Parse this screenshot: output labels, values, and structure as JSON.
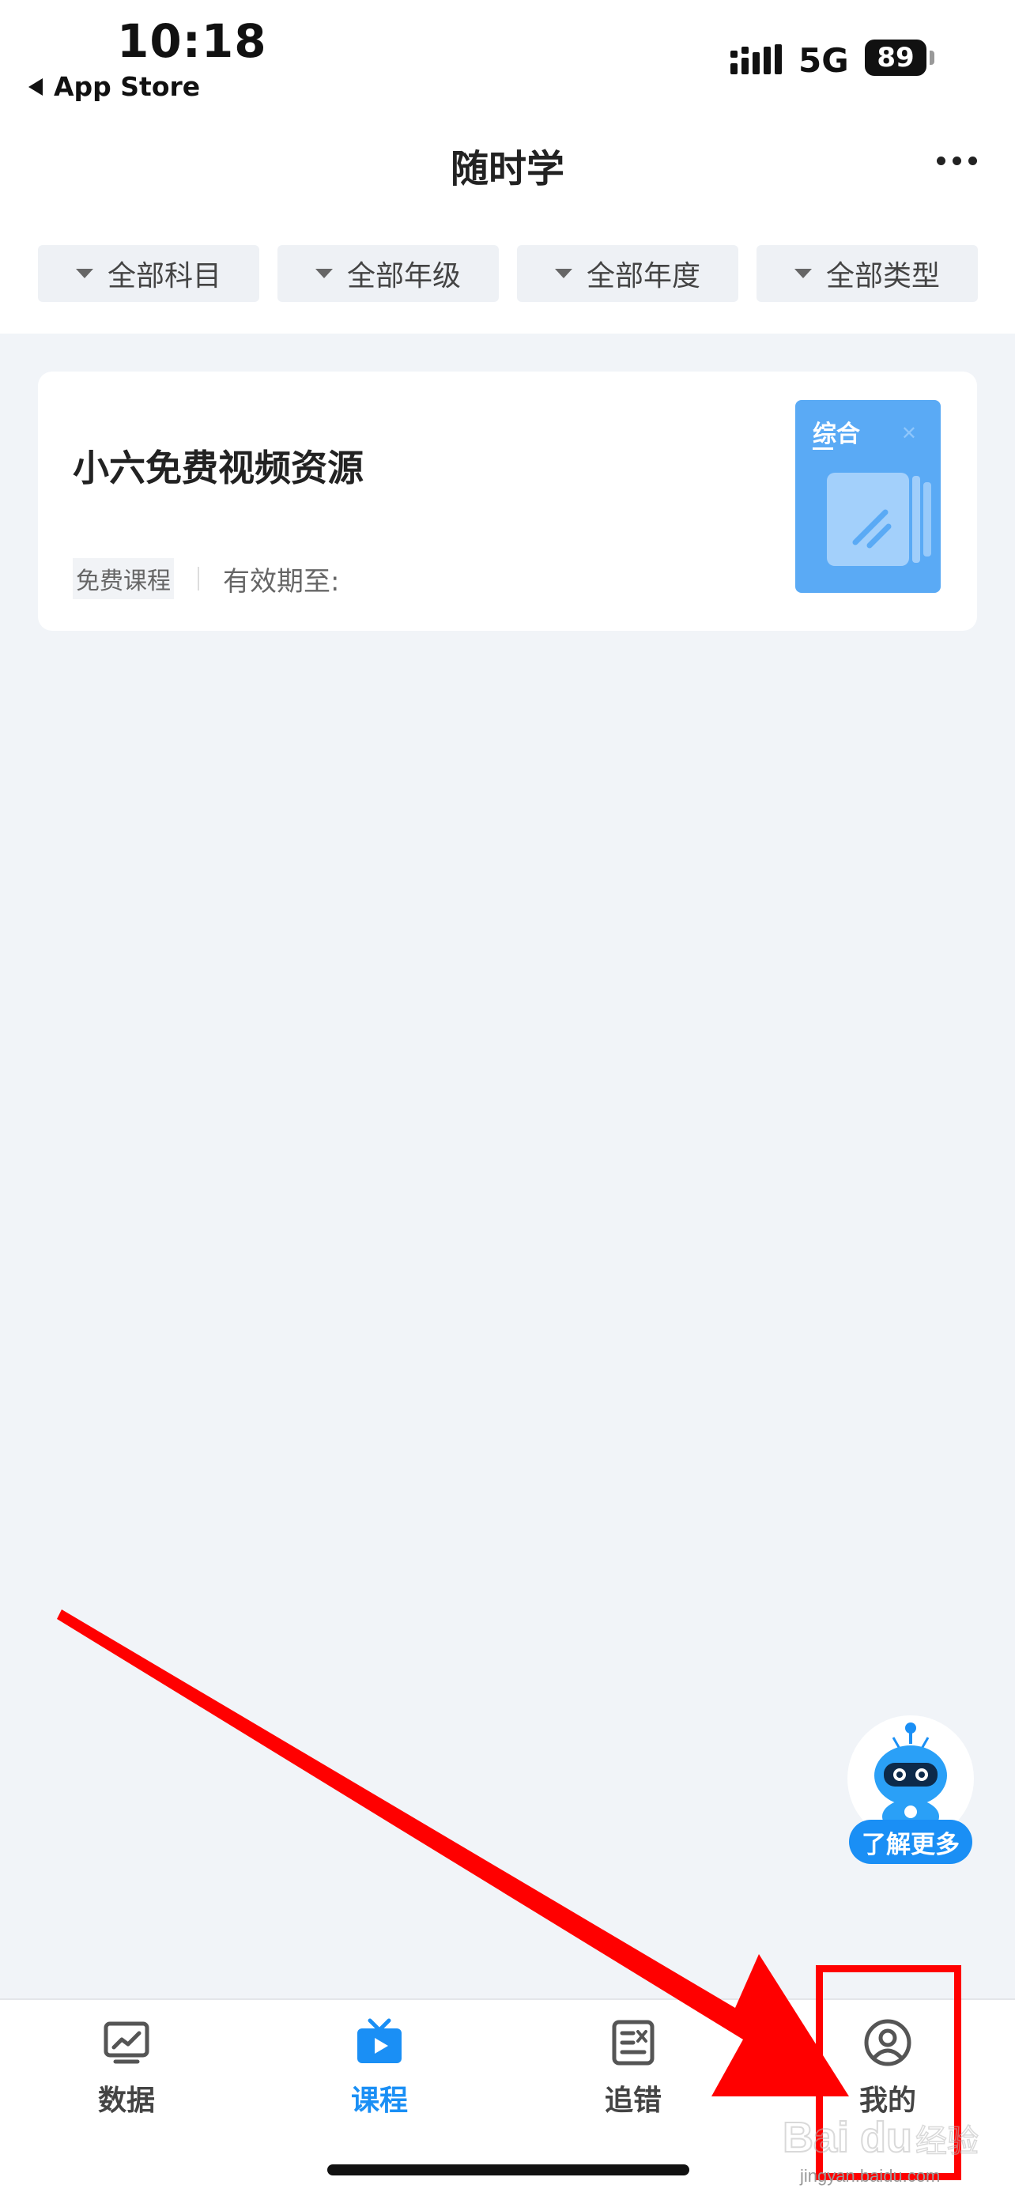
{
  "status_bar": {
    "time": "10:18",
    "back_app": "App Store",
    "network": "5G",
    "battery": "89",
    "icons": [
      "signal-icon",
      "battery-icon"
    ]
  },
  "nav": {
    "title": "随时学",
    "more_icon": "more-icon"
  },
  "filters": [
    {
      "label": "全部科目"
    },
    {
      "label": "全部年级"
    },
    {
      "label": "全部年度"
    },
    {
      "label": "全部类型"
    }
  ],
  "course": {
    "title": "小六免费视频资源",
    "tag": "免费课程",
    "validity": "有效期至:",
    "thumb_label": "综合",
    "thumb_color": "#5aaaf5"
  },
  "assistant": {
    "label": "了解更多"
  },
  "tabs": [
    {
      "label": "数据",
      "icon": "chart-icon"
    },
    {
      "label": "课程",
      "icon": "tv-play-icon",
      "active": true
    },
    {
      "label": "追错",
      "icon": "error-book-icon"
    },
    {
      "label": "我的",
      "icon": "user-icon"
    }
  ],
  "colors": {
    "accent": "#1a8ff5",
    "page_bg": "#f1f4f8",
    "annotation": "#ff0000"
  },
  "watermark": {
    "text": "jingyan.baidu.com"
  }
}
